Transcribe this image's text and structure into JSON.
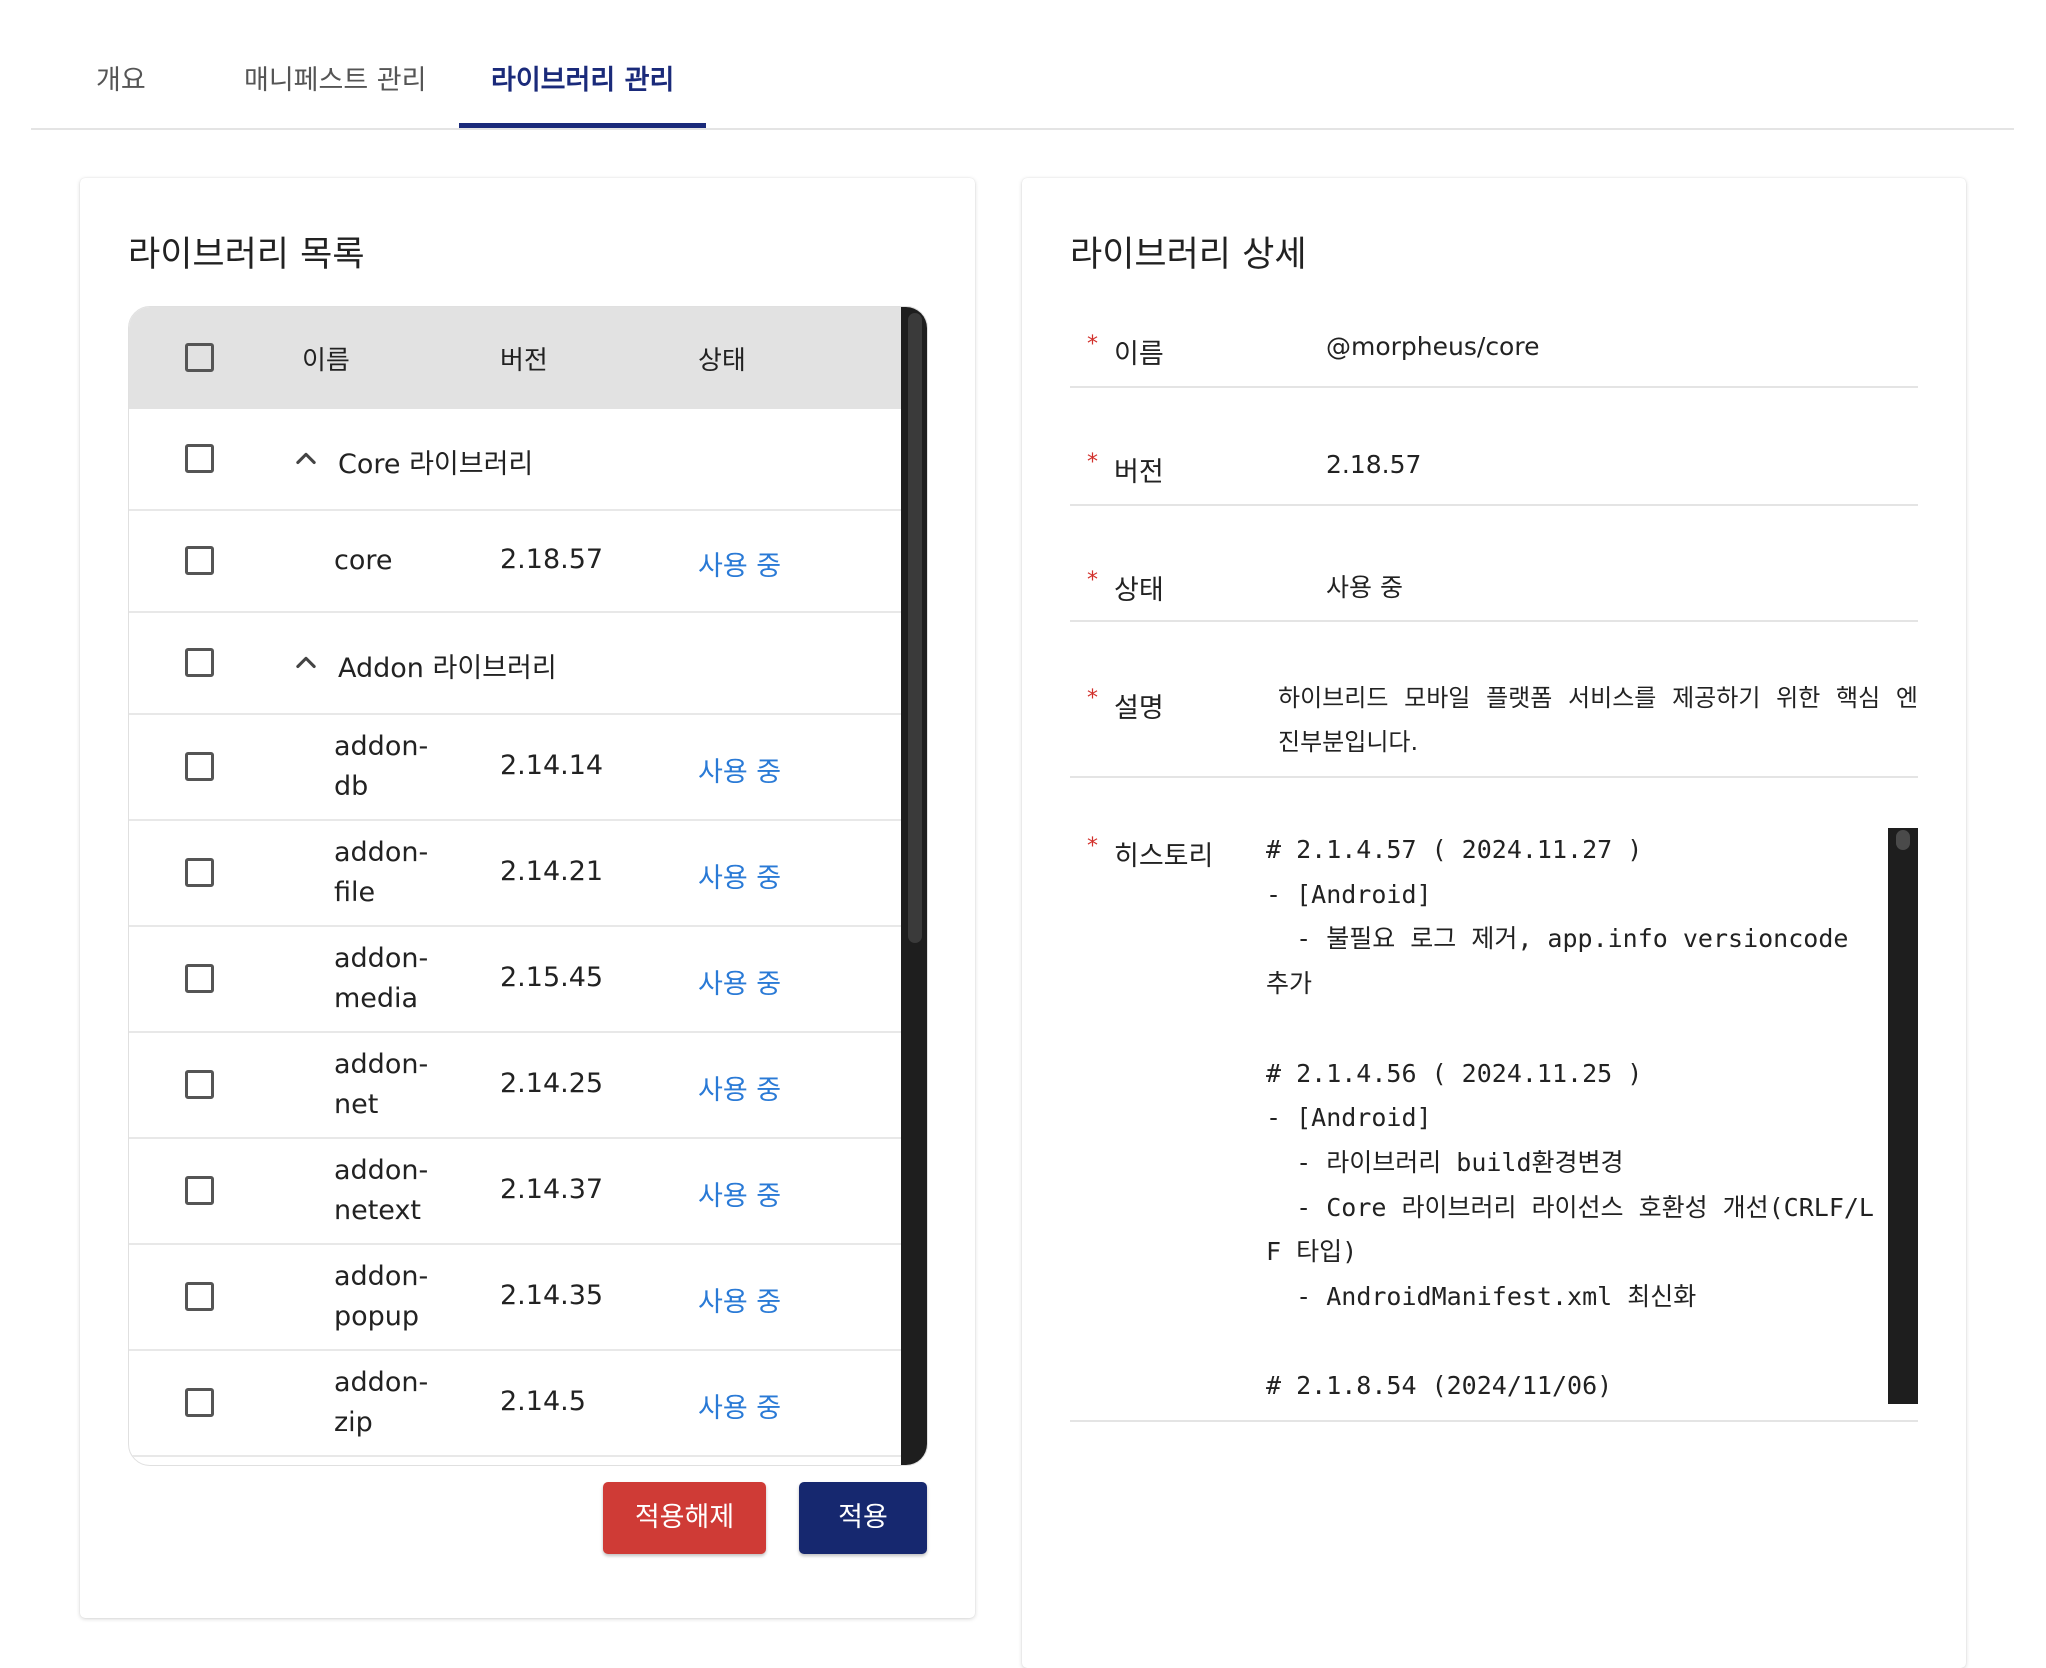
{
  "tabs": [
    {
      "label": "개요",
      "active": false
    },
    {
      "label": "매니페스트 관리",
      "active": false
    },
    {
      "label": "라이브러리 관리",
      "active": true
    }
  ],
  "colors": {
    "accent": "#1a2a7a",
    "status_link": "#2a7ad6",
    "danger_button": "#cf3b36",
    "primary_button": "#16286f",
    "required_mark": "#d2312c"
  },
  "library_list": {
    "title": "라이브러리 목록",
    "columns": {
      "name": "이름",
      "version": "버전",
      "status": "상태"
    },
    "groups": [
      {
        "label": "Core 라이브러리",
        "expanded": true,
        "icon": "chevron-up-icon",
        "items": [
          {
            "name": "core",
            "version": "2.18.57",
            "status": "사용 중"
          }
        ]
      },
      {
        "label": "Addon 라이브러리",
        "expanded": true,
        "icon": "chevron-up-icon",
        "items": [
          {
            "name": "addon-\ndb",
            "version": "2.14.14",
            "status": "사용 중"
          },
          {
            "name": "addon-\nfile",
            "version": "2.14.21",
            "status": "사용 중"
          },
          {
            "name": "addon-\nmedia",
            "version": "2.15.45",
            "status": "사용 중"
          },
          {
            "name": "addon-\nnet",
            "version": "2.14.25",
            "status": "사용 중"
          },
          {
            "name": "addon-\nnetext",
            "version": "2.14.37",
            "status": "사용 중"
          },
          {
            "name": "addon-\npopup",
            "version": "2.14.35",
            "status": "사용 중"
          },
          {
            "name": "addon-\nzip",
            "version": "2.14.5",
            "status": "사용 중"
          }
        ]
      }
    ],
    "buttons": {
      "unapply": "적용해제",
      "apply": "적용"
    }
  },
  "library_detail": {
    "title": "라이브러리 상세",
    "required_mark": "*",
    "fields": {
      "name": {
        "label": "이름",
        "value": "@morpheus/core"
      },
      "version": {
        "label": "버전",
        "value": "2.18.57"
      },
      "status": {
        "label": "상태",
        "value": "사용 중"
      },
      "description": {
        "label": "설명",
        "value": "하이브리드 모바일 플랫폼 서비스를 제공하기 위한 핵심 엔진부분입니다."
      },
      "history": {
        "label": "히스토리",
        "value": "# 2.1.4.57 ( 2024.11.27 )\n- [Android]\n  - 불필요 로그 제거, app.info versioncode 추가\n\n# 2.1.4.56 ( 2024.11.25 )\n- [Android]\n  - 라이브러리 build환경변경\n  - Core 라이브러리 라이선스 호환성 개선(CRLF/LF 타입)\n  - AndroidManifest.xml 최신화\n\n# 2.1.8.54 (2024/11/06)"
      }
    }
  }
}
